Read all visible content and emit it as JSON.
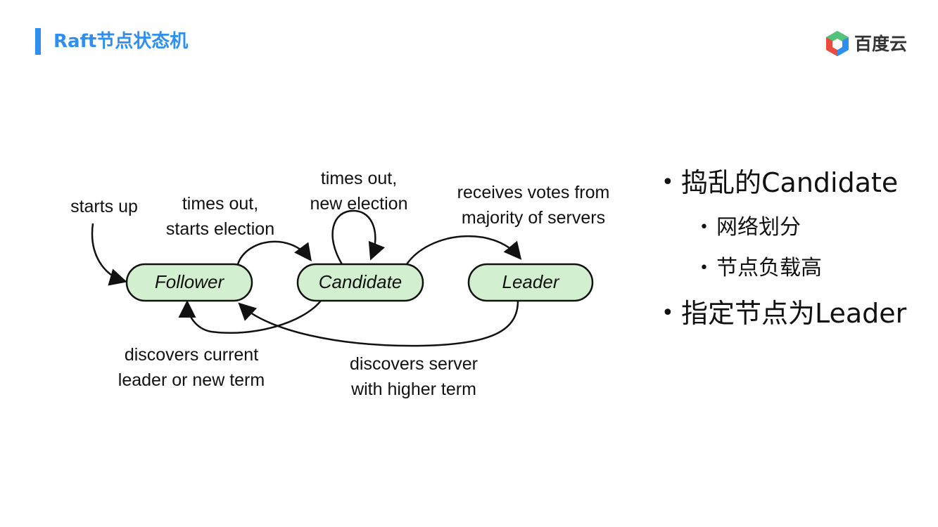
{
  "header": {
    "title": "Raft节点状态机",
    "logo_text": "百度云"
  },
  "diagram": {
    "states": [
      "Follower",
      "Candidate",
      "Leader"
    ],
    "labels": {
      "starts_up": "starts up",
      "times_out_starts_election": [
        "times out,",
        "starts election"
      ],
      "times_out_new_election": [
        "times out,",
        "new election"
      ],
      "receives_votes": [
        "receives votes from",
        "majority of servers"
      ],
      "discovers_current_leader": [
        "discovers current",
        "leader or new term"
      ],
      "discovers_server_higher_term": [
        "discovers server",
        "with higher term"
      ]
    },
    "colors": {
      "state_fill": "#d2f0cf",
      "stroke": "#111111"
    }
  },
  "bullets": [
    {
      "level": 1,
      "text": "捣乱的Candidate"
    },
    {
      "level": 2,
      "text": "网络划分"
    },
    {
      "level": 2,
      "text": "节点负载高"
    },
    {
      "level": 1,
      "text": "指定节点为Leader"
    }
  ],
  "theme": {
    "accent": "#2f8ff0"
  }
}
